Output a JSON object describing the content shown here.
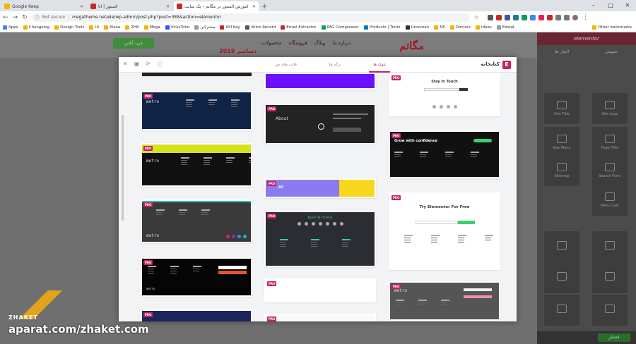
{
  "browser": {
    "tabs": [
      {
        "title": "Google Keep",
        "color": "#f4b400"
      },
      {
        "title": "المنتور | ﺍﺗﺎ",
        "color": "#c62828"
      },
      {
        "title": "آموزش المنتور در مگاتم – یک سایت",
        "color": "#c62828"
      }
    ],
    "address": {
      "not_secure": "Not secure",
      "url": "megatheme.net/ele/wp-admin/post.php?post=385&action=elementor"
    },
    "bookmarks": [
      "Apps",
      "Changelog",
      "Design Tools",
      "UI",
      "Alexa",
      "ZHK",
      "Mega",
      "VirusTotal",
      "مشترکین",
      "API Key",
      "Voice Record",
      "Email Extractor",
      "IMG Compressor",
      "Products | Trello",
      "Unscreen",
      "NP",
      "Doctors",
      "Ideas",
      "Edalat"
    ],
    "other_bookmarks": "Other bookmarks"
  },
  "site": {
    "logo": "مگاتم",
    "subtitle": "دسامبر 2019",
    "menu": [
      "درباره ما",
      "وبلاگ",
      "فروشگاه",
      "محصولات"
    ],
    "button": "خرید آنلاین"
  },
  "sidebar": {
    "brand": "elementor",
    "tabs": [
      "المان ها",
      "عمومی"
    ],
    "widgets": [
      "Site Title",
      "Site Logo",
      "Nav Menu",
      "Page Title",
      "Sitemap",
      "Search Form",
      "Menu Cart",
      "",
      "",
      "",
      "",
      "",
      "",
      ""
    ],
    "publish": "انتشار"
  },
  "modal": {
    "title": "کتابخانه",
    "tabs": [
      "بلوک ها",
      "برگه ها",
      "قالب های من"
    ],
    "active_tab": 0
  },
  "templates": {
    "metro": "metro",
    "about": "About",
    "stay": "Stay in Touch",
    "grow": "Grow with confidence",
    "try": "Try Elementor For Free",
    "keep": "KEEP IN TOUCH",
    "ac": "AC",
    "pro": "PRO"
  },
  "watermark": {
    "brand": "ZHAKET",
    "url": "aparat.com/zhaket.com"
  }
}
